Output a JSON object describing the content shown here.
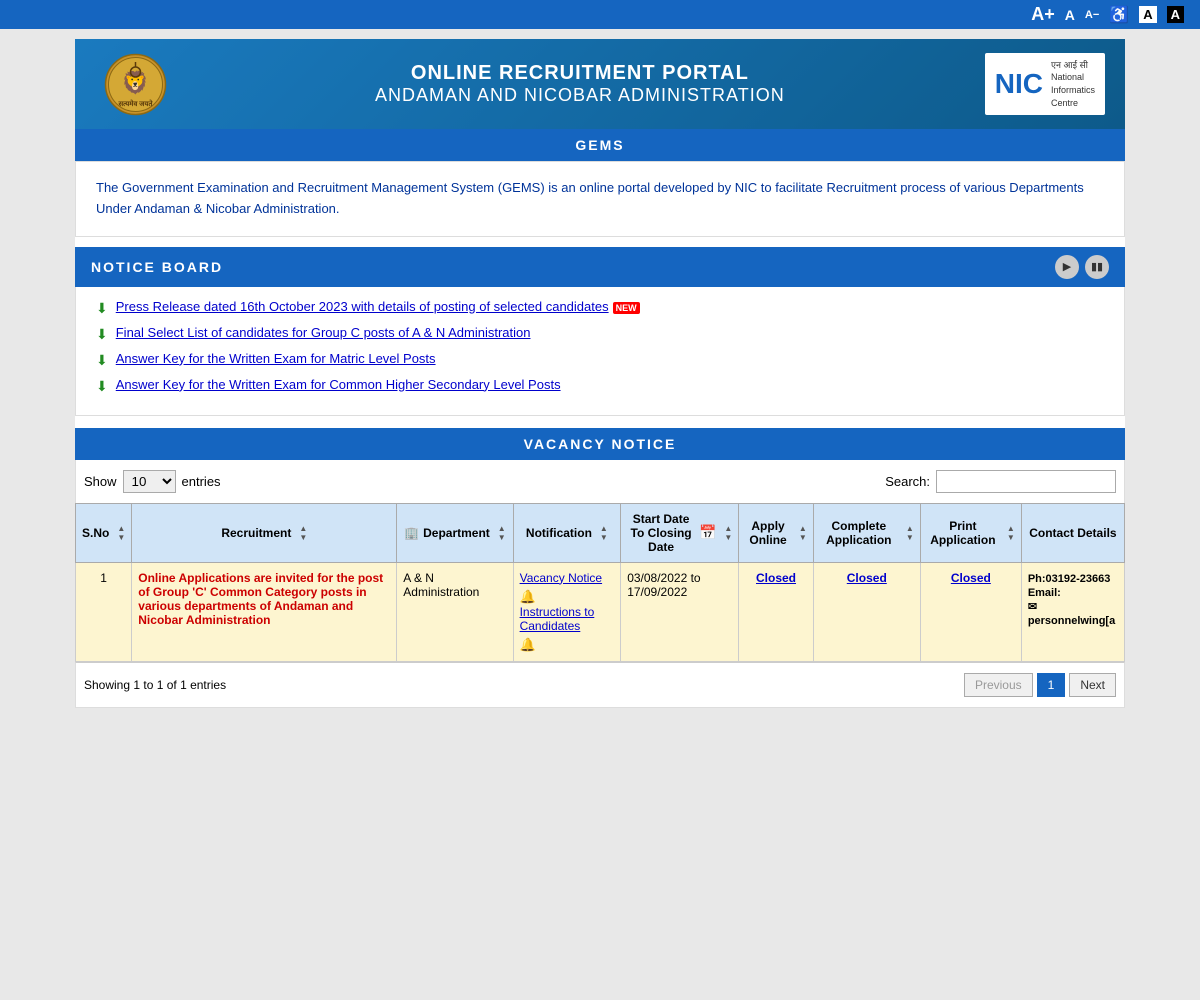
{
  "topbar": {
    "a_plus": "A+",
    "a_normal": "A",
    "a_minus": "A−",
    "accessibility_icon": "♿",
    "contrast_a": "A",
    "contrast_b": "A"
  },
  "header": {
    "title_main": "ONLINE RECRUITMENT PORTAL",
    "title_sub": "ANDAMAN AND NICOBAR ADMINISTRATION",
    "nic_text": "NIC",
    "nic_line1": "एन आई सी",
    "nic_line2": "National",
    "nic_line3": "Informatics",
    "nic_line4": "Centre"
  },
  "gems_bar": {
    "label": "GEMS"
  },
  "gems_desc": "The Government Examination and Recruitment Management System (GEMS) is an online portal developed by NIC to facilitate Recruitment process of various Departments Under Andaman & Nicobar Administration.",
  "notice_board": {
    "title": "NOTICE BOARD",
    "items": [
      {
        "text": "Press Release dated 16th October 2023 with details of posting of selected candidates",
        "is_new": true
      },
      {
        "text": "Final Select List of candidates for Group C posts of A & N Administration",
        "is_new": false
      },
      {
        "text": "Answer Key for the Written Exam for Matric Level Posts",
        "is_new": false
      },
      {
        "text": "Answer Key for the Written Exam for Common Higher Secondary Level Posts",
        "is_new": false
      }
    ]
  },
  "vacancy_notice": {
    "title": "VACANCY NOTICE",
    "show_label": "Show",
    "entries_label": "entries",
    "search_label": "Search:",
    "columns": [
      "S.No",
      "Recruitment",
      "Department",
      "Notification",
      "Start Date To Closing Date",
      "Apply Online",
      "Complete Application",
      "Print Application",
      "Contact Details"
    ],
    "rows": [
      {
        "sno": "1",
        "recruitment": "Online Applications are invited for the post of Group 'C' Common Category posts in various departments of Andaman and Nicobar Administration",
        "department": "A & N Administration",
        "notification_links": [
          "Vacancy Notice",
          "Instructions to Candidates"
        ],
        "date_range": "03/08/2022 to 17/09/2022",
        "apply_online": "Closed",
        "complete_application": "Closed",
        "print_application": "Closed",
        "contact": "Ph:03192-23663\nEmail:\npersonnelwing[a"
      }
    ],
    "pagination": {
      "showing": "Showing 1 to 1 of 1 entries",
      "previous": "Previous",
      "page1": "1",
      "next": "Next"
    }
  }
}
